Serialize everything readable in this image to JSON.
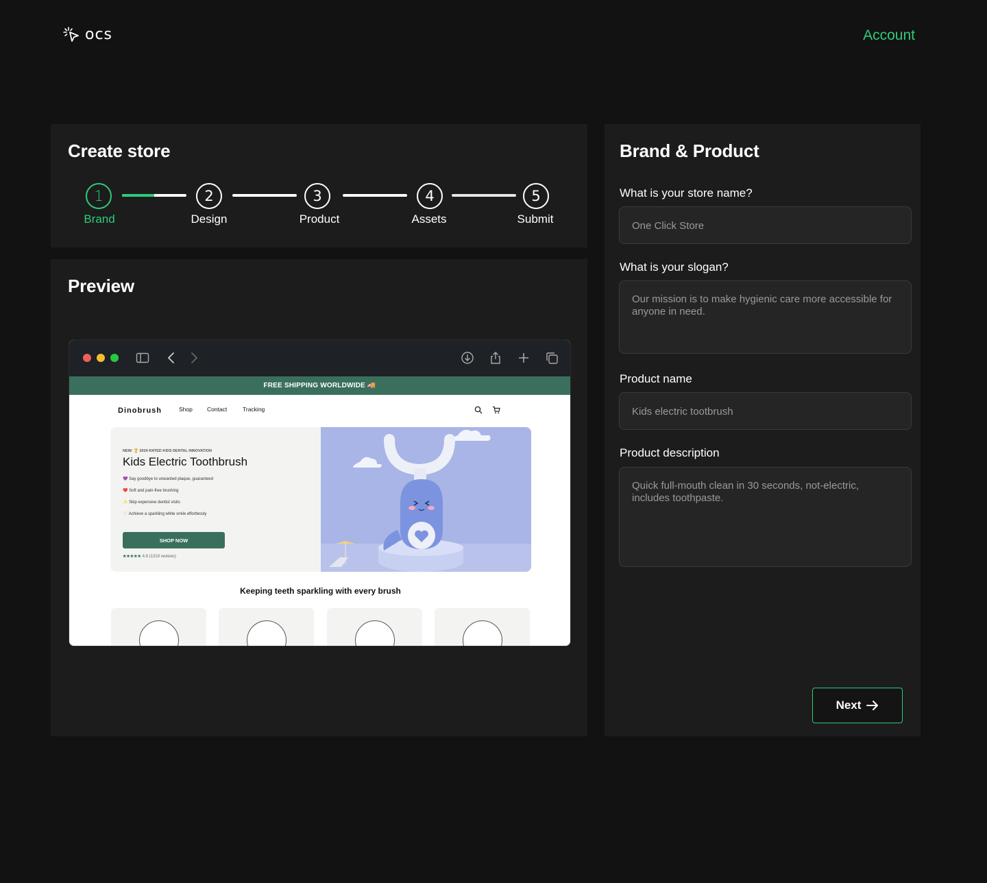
{
  "header": {
    "logo_text": "ocs",
    "account_label": "Account",
    "accent_color": "#2ecc7a"
  },
  "create_store": {
    "title": "Create store",
    "steps": [
      {
        "number": "1",
        "label": "Brand"
      },
      {
        "number": "2",
        "label": "Design"
      },
      {
        "number": "3",
        "label": "Product"
      },
      {
        "number": "4",
        "label": "Assets"
      },
      {
        "number": "5",
        "label": "Submit"
      }
    ],
    "active_step": 1,
    "first_connector_progress": 0.5
  },
  "preview": {
    "title": "Preview",
    "site": {
      "shipping_banner": "FREE SHIPPING WORLDWIDE",
      "brand": "Dinobrush",
      "nav": [
        "Shop",
        "Contact",
        "Tracking"
      ],
      "hero_kicker": "NEW: 🏆 2024 RATED KIDS DENTAL INNOVATION",
      "hero_title": "Kids Electric Toothbrush",
      "bullets": [
        "💜 Say goodbye to unwanted plaque, guaranteed",
        "❤️ Soft and pain-free brushing",
        "✨ Skip expensive dentist visits",
        "🦷 Achieve a sparkling white smile effortlessly"
      ],
      "shop_button": "SHOP NOW",
      "rating_stars": "★★★★★",
      "rating_text": "4.8 (1319 reviews)",
      "tagline": "Keeping teeth sparkling with every brush"
    }
  },
  "form": {
    "title": "Brand & Product",
    "store_name_label": "What is your store name?",
    "store_name_value": "One Click Store",
    "slogan_label": "What is your slogan?",
    "slogan_value": "Our mission is to make hygienic care more accessible for anyone in need.",
    "product_name_label": "Product name",
    "product_name_value": "Kids electric tootbrush",
    "product_desc_label": "Product description",
    "product_desc_value": "Quick full-mouth clean in 30 seconds, not-electric, includes toothpaste.",
    "next_label": "Next"
  }
}
